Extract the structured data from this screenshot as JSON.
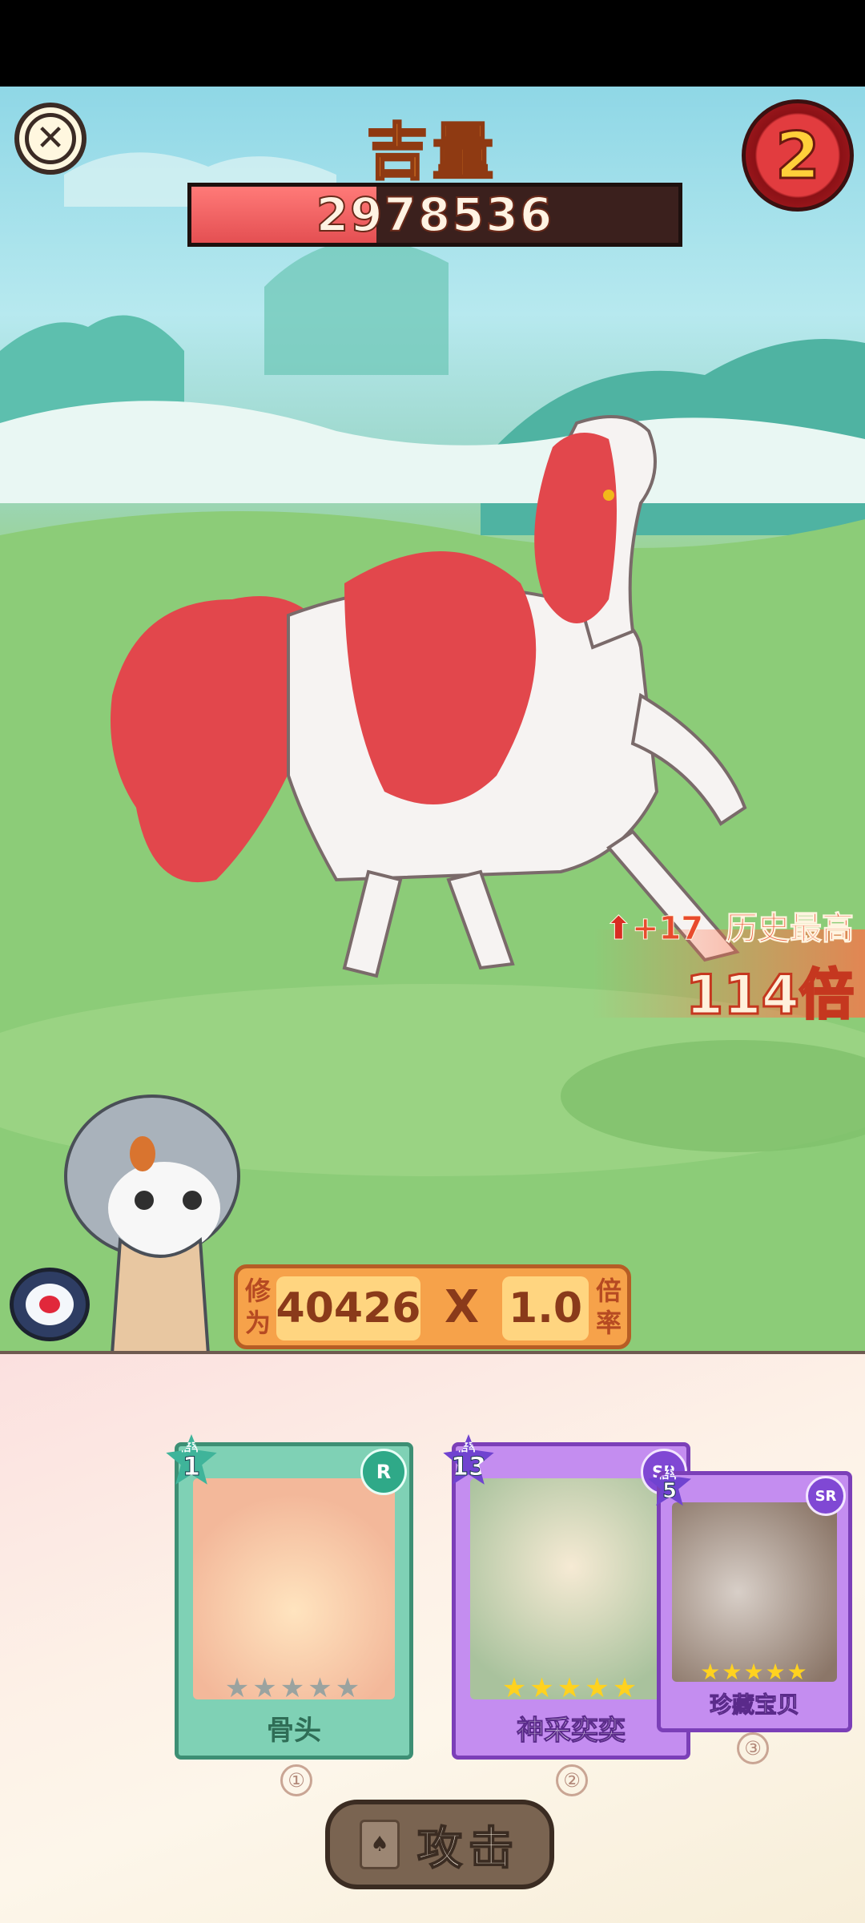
{
  "boss": {
    "name": "吉量",
    "hp": "2978536",
    "hp_ratio": 0.38
  },
  "round": {
    "value": "2"
  },
  "record": {
    "delta": "+17",
    "label": "历史最高",
    "value": "114倍"
  },
  "calc": {
    "cultivation_label_1": "修",
    "cultivation_label_2": "为",
    "cultivation_value": "40426",
    "operator": "X",
    "multiplier_value": "1.0",
    "multiplier_label_1": "倍",
    "multiplier_label_2": "率"
  },
  "cards": [
    {
      "name": "骨头",
      "rate_label": "倍率",
      "rate": "1",
      "rarity": "R",
      "stars_total": 5,
      "stars_filled": 0,
      "slot": "①"
    },
    {
      "name": "神采奕奕",
      "rate_label": "倍率",
      "rate": "13",
      "rarity": "SR",
      "stars_total": 5,
      "stars_filled": 5,
      "slot": "②"
    },
    {
      "name": "珍藏宝贝",
      "rate_label": "倍率",
      "rate": "5",
      "rarity": "SR",
      "stars_total": 5,
      "stars_filled": 5,
      "slot": "③"
    }
  ],
  "attack_button": {
    "label": "攻击"
  },
  "icons": {
    "close": "close-icon",
    "target": "target-icon",
    "attack_card": "card-icon"
  },
  "colors": {
    "hp_fill": "#e44f52",
    "accent_orange": "#ff9a2f",
    "round_red": "#e23c3f"
  }
}
